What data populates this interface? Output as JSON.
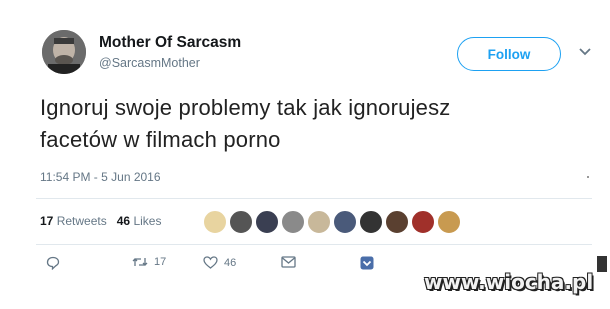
{
  "user": {
    "name": "Mother Of Sarcasm",
    "handle": "@SarcasmMother"
  },
  "follow_label": "Follow",
  "tweet": {
    "line1": "Ignoruj swoje problemy tak jak ignorujesz",
    "line2": "facetów w filmach porno"
  },
  "timestamp": "11:54 PM - 5 Jun 2016",
  "stats": {
    "retweets_count": "17",
    "retweets_label": "Retweets",
    "likes_count": "46",
    "likes_label": "Likes"
  },
  "actions": {
    "retweet_count": "17",
    "like_count": "46"
  },
  "watermark": "www.wiocha.pl",
  "colors": {
    "accent": "#1da1f2",
    "muted": "#657786",
    "divider": "#e1e8ed"
  }
}
